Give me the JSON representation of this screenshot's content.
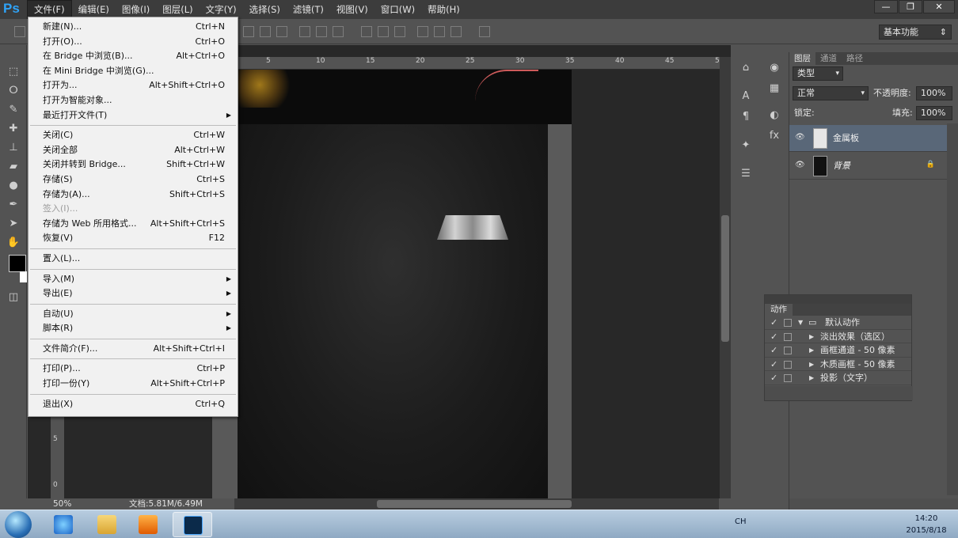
{
  "app": {
    "logo": "Ps",
    "window_controls": [
      "—",
      "❐",
      "✕"
    ]
  },
  "menubar": {
    "items": [
      "文件(F)",
      "编辑(E)",
      "图像(I)",
      "图层(L)",
      "文字(Y)",
      "选择(S)",
      "滤镜(T)",
      "视图(V)",
      "窗口(W)",
      "帮助(H)"
    ],
    "active_index": 0
  },
  "options_bar": {
    "workspace": "基本功能"
  },
  "file_menu": {
    "groups": [
      [
        {
          "label": "新建(N)...",
          "shortcut": "Ctrl+N"
        },
        {
          "label": "打开(O)...",
          "shortcut": "Ctrl+O"
        },
        {
          "label": "在 Bridge 中浏览(B)...",
          "shortcut": "Alt+Ctrl+O"
        },
        {
          "label": "在 Mini Bridge 中浏览(G)...",
          "shortcut": ""
        },
        {
          "label": "打开为...",
          "shortcut": "Alt+Shift+Ctrl+O"
        },
        {
          "label": "打开为智能对象...",
          "shortcut": ""
        },
        {
          "label": "最近打开文件(T)",
          "shortcut": "",
          "submenu": true
        }
      ],
      [
        {
          "label": "关闭(C)",
          "shortcut": "Ctrl+W"
        },
        {
          "label": "关闭全部",
          "shortcut": "Alt+Ctrl+W"
        },
        {
          "label": "关闭并转到 Bridge...",
          "shortcut": "Shift+Ctrl+W"
        },
        {
          "label": "存储(S)",
          "shortcut": "Ctrl+S"
        },
        {
          "label": "存储为(A)...",
          "shortcut": "Shift+Ctrl+S"
        },
        {
          "label": "签入(I)...",
          "shortcut": "",
          "disabled": true
        },
        {
          "label": "存储为 Web 所用格式...",
          "shortcut": "Alt+Shift+Ctrl+S"
        },
        {
          "label": "恢复(V)",
          "shortcut": "F12"
        }
      ],
      [
        {
          "label": "置入(L)...",
          "shortcut": ""
        }
      ],
      [
        {
          "label": "导入(M)",
          "shortcut": "",
          "submenu": true
        },
        {
          "label": "导出(E)",
          "shortcut": "",
          "submenu": true
        }
      ],
      [
        {
          "label": "自动(U)",
          "shortcut": "",
          "submenu": true
        },
        {
          "label": "脚本(R)",
          "shortcut": "",
          "submenu": true
        }
      ],
      [
        {
          "label": "文件简介(F)...",
          "shortcut": "Alt+Shift+Ctrl+I"
        }
      ],
      [
        {
          "label": "打印(P)...",
          "shortcut": "Ctrl+P"
        },
        {
          "label": "打印一份(Y)",
          "shortcut": "Alt+Shift+Ctrl+P"
        }
      ],
      [
        {
          "label": "退出(X)",
          "shortcut": "Ctrl+Q"
        }
      ]
    ]
  },
  "ruler": {
    "top_ticks": [
      "5",
      "10",
      "15",
      "20",
      "25",
      "30",
      "35",
      "40",
      "45",
      "50"
    ],
    "left_ticks": [
      "5",
      "0",
      "5"
    ]
  },
  "status": {
    "zoom": "50%",
    "doc": "文档:5.81M/6.49M"
  },
  "layers_panel": {
    "tabs": [
      "图层",
      "通道",
      "路径"
    ],
    "active_tab": 0,
    "filter": "类型",
    "blend_mode": "正常",
    "opacity_label": "不透明度:",
    "opacity": "100%",
    "lock_label": "锁定:",
    "fill_label": "填充:",
    "fill": "100%",
    "layers": [
      {
        "name": "金属板",
        "selected": true
      },
      {
        "name": "背景",
        "selected": false,
        "locked": true
      }
    ]
  },
  "actions_panel": {
    "tab": "动作",
    "set_name": "默认动作",
    "items": [
      "淡出效果（选区）",
      "画框通道 - 50 像素",
      "木质画框 - 50 像素",
      "投影（文字）"
    ]
  },
  "taskbar": {
    "lang": "CH",
    "time": "14:20",
    "date": "2015/8/18"
  },
  "colors": {
    "accent": "#2fa3f7",
    "selected_layer": "#596778"
  }
}
